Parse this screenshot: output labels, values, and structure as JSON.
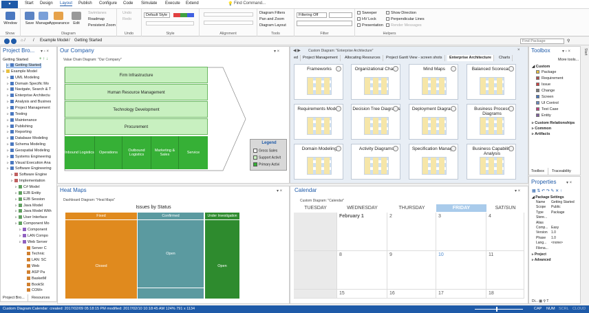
{
  "menu": {
    "app": "▾",
    "items": [
      "Start",
      "Design",
      "Layout",
      "Publish",
      "Configure",
      "Code",
      "Simulate",
      "Execute",
      "Extend"
    ],
    "active": "Layout",
    "find": "Find Command..."
  },
  "ribbon": {
    "show": {
      "label": "Show",
      "window": "Window"
    },
    "diagram": {
      "label": "Diagram",
      "save": "Save",
      "manage": "Manage",
      "appearance": "Appearance",
      "edit": "Edit",
      "swimlanes": "Swimlanes",
      "roadmap": "Roadmap",
      "zoom": "Persistent Zoom"
    },
    "undo": {
      "label": "Undo",
      "undo": "Undo",
      "redo": "Redo"
    },
    "style": {
      "label": "Style",
      "default": "Default Style"
    },
    "alignment": {
      "label": "Alignment"
    },
    "tools": {
      "label": "Tools",
      "filters": "Diagram Filters",
      "pan": "Pan and Zoom",
      "layout": "Diagram Layout"
    },
    "filter": {
      "label": "Filter",
      "filtering": "Filtering Off"
    },
    "helpers": {
      "label": "Helpers",
      "sweeper": "Sweeper",
      "hvlock": "HV Lock",
      "presentation": "Presentation",
      "showdir": "Show Direction",
      "perp": "Perpendicular Lines",
      "render": "Render Messages"
    }
  },
  "nav": {
    "crumb1": "Example Model",
    "crumb2": "Getting Started",
    "find": "Find Package"
  },
  "browser": {
    "title": "Project Bro...",
    "header": "Getting Started",
    "items": [
      {
        "label": "Getting Started",
        "indent": 1,
        "sel": true
      },
      {
        "label": "Example Model",
        "indent": 0
      },
      {
        "label": "UML Modeling",
        "indent": 1
      },
      {
        "label": "Domain Specific Mo",
        "indent": 1
      },
      {
        "label": "Navigate, Search & T",
        "indent": 1
      },
      {
        "label": "Enterprise Architectu",
        "indent": 1
      },
      {
        "label": "Analysis and Busines",
        "indent": 1
      },
      {
        "label": "Project Management",
        "indent": 1
      },
      {
        "label": "Testing",
        "indent": 1
      },
      {
        "label": "Maintenance",
        "indent": 1
      },
      {
        "label": "Publishing",
        "indent": 1
      },
      {
        "label": "Reporting",
        "indent": 1
      },
      {
        "label": "Database Modeling",
        "indent": 1
      },
      {
        "label": "Schema Modeling",
        "indent": 1
      },
      {
        "label": "Geospatial Modeling",
        "indent": 1
      },
      {
        "label": "Systems Engineering",
        "indent": 1
      },
      {
        "label": "Visual Execution Ana",
        "indent": 1
      },
      {
        "label": "Software Engineering",
        "indent": 1
      },
      {
        "label": "Software Engine",
        "indent": 2
      },
      {
        "label": "Implementation",
        "indent": 2
      },
      {
        "label": "C# Model",
        "indent": 3
      },
      {
        "label": "EJB Entity",
        "indent": 3
      },
      {
        "label": "EJB Session",
        "indent": 3
      },
      {
        "label": "Java Model",
        "indent": 3
      },
      {
        "label": "Java Model With",
        "indent": 3
      },
      {
        "label": "User Interface",
        "indent": 3
      },
      {
        "label": "Component Mo",
        "indent": 3
      },
      {
        "label": "Component",
        "indent": 4
      },
      {
        "label": "LAN Compo",
        "indent": 4
      },
      {
        "label": "Web Server",
        "indent": 4
      },
      {
        "label": "Server C",
        "indent": 5
      },
      {
        "label": "Technic",
        "indent": 5
      },
      {
        "label": "LAN: SC",
        "indent": 5
      },
      {
        "label": "Web",
        "indent": 5
      },
      {
        "label": "ASP Pa",
        "indent": 5
      },
      {
        "label": "BasketM",
        "indent": 5
      },
      {
        "label": "BookSt",
        "indent": 5
      },
      {
        "label": "COM+",
        "indent": 5
      }
    ],
    "tab1": "Project Bro...",
    "tab2": "Resources"
  },
  "company": {
    "title": "Our Company",
    "subtitle": "Value Chain Diagram: \"Our Company\"",
    "rows": [
      "Firm Infrastructure",
      "Human Resource Management",
      "Technology Development",
      "Procurement"
    ],
    "activities": [
      "Inbound Logistics",
      "Operations",
      "Outbound Logistics",
      "Marketing & Sales",
      "Service"
    ],
    "legend": {
      "title": "Legend",
      "items": [
        {
          "label": "Gross Sales",
          "color": "#ffffff"
        },
        {
          "label": "Support Activit",
          "color": "#c8f0c0"
        },
        {
          "label": "Primary Activi",
          "color": "#36b036"
        }
      ]
    }
  },
  "ea": {
    "subtitle": "Custom Diagram: \"Enterprise Architecture\"",
    "tabs": [
      "ed",
      "Project Management",
      "Allocating Resources",
      "Project Gantt View - screen shots",
      "Enterprise Architecture",
      "Charts"
    ],
    "activeTab": "Enterprise Architecture",
    "tiles": [
      "Frameworks",
      "Organizational Charts",
      "Mind Maps",
      "Balanced Scorecard",
      "Requirements Models",
      "Decision Tree Diagrams",
      "Deployment Diagrams",
      "Business Process Diagrams",
      "Domain Modeling",
      "Activity Diagrams",
      "Specification Manager",
      "Business Capability Analysis"
    ]
  },
  "toolbox": {
    "title": "Toolbox",
    "more": "More tools...",
    "custom": "Custom",
    "items": [
      "Package",
      "Requirement",
      "Issue",
      "Change",
      "Screen",
      "UI Control",
      "Test Case",
      "Entity"
    ],
    "groups": [
      "Custom Relationships",
      "Common",
      "Artifacts"
    ],
    "tab1": "Toolbox",
    "tab2": "Traceability"
  },
  "heatmap": {
    "title": "Heat Maps",
    "subtitle": "Dashboard Diagram: \"Heat Maps\"",
    "chart": "Issues by Status",
    "cols": [
      {
        "label": "Fixed",
        "cell": "Closed",
        "color": "#e08a1e"
      },
      {
        "label": "Confirmed",
        "cell": "Open",
        "color": "#5b9aa0"
      },
      {
        "label": "Under Investigation",
        "cell": "Open",
        "color": "#2e8b2e"
      }
    ]
  },
  "calendar": {
    "title": "Calendar",
    "subtitle": "Custom Diagram: \"Calendar\"",
    "days": [
      "TUESDAY",
      "WEDNESDAY",
      "THURSDAY",
      "FRIDAY",
      "SAT/SUN"
    ],
    "activeDay": "FRIDAY",
    "rows": [
      [
        "",
        "February 1",
        "2",
        "3",
        "4"
      ],
      [
        "",
        "8",
        "9",
        "10",
        "11"
      ],
      [
        "",
        "15",
        "16",
        "17",
        "18"
      ]
    ]
  },
  "props": {
    "title": "Properties",
    "section": "Package Settings",
    "fields": [
      [
        "Name",
        "Getting Started"
      ],
      [
        "Scope",
        "Public"
      ],
      [
        "Type",
        "Package"
      ],
      [
        "Stere...",
        ""
      ],
      [
        "Alias",
        ""
      ],
      [
        "Comp...",
        "Easy"
      ],
      [
        "Version",
        "1.0"
      ],
      [
        "Phase",
        "1.0"
      ],
      [
        "Lang...",
        "<none>"
      ],
      [
        "Filena...",
        ""
      ]
    ],
    "groups": [
      "Project",
      "Advanced"
    ]
  },
  "status": {
    "text": "Custom Diagram:Calendar:  created: 2017/02/09 05:18:15 PM  modified: 2017/02/10 10:18:45 AM  124%  791 x 1134",
    "caps": "CAP",
    "num": "NUM",
    "scrl": "SCRL",
    "cloud": "CLOUD"
  }
}
